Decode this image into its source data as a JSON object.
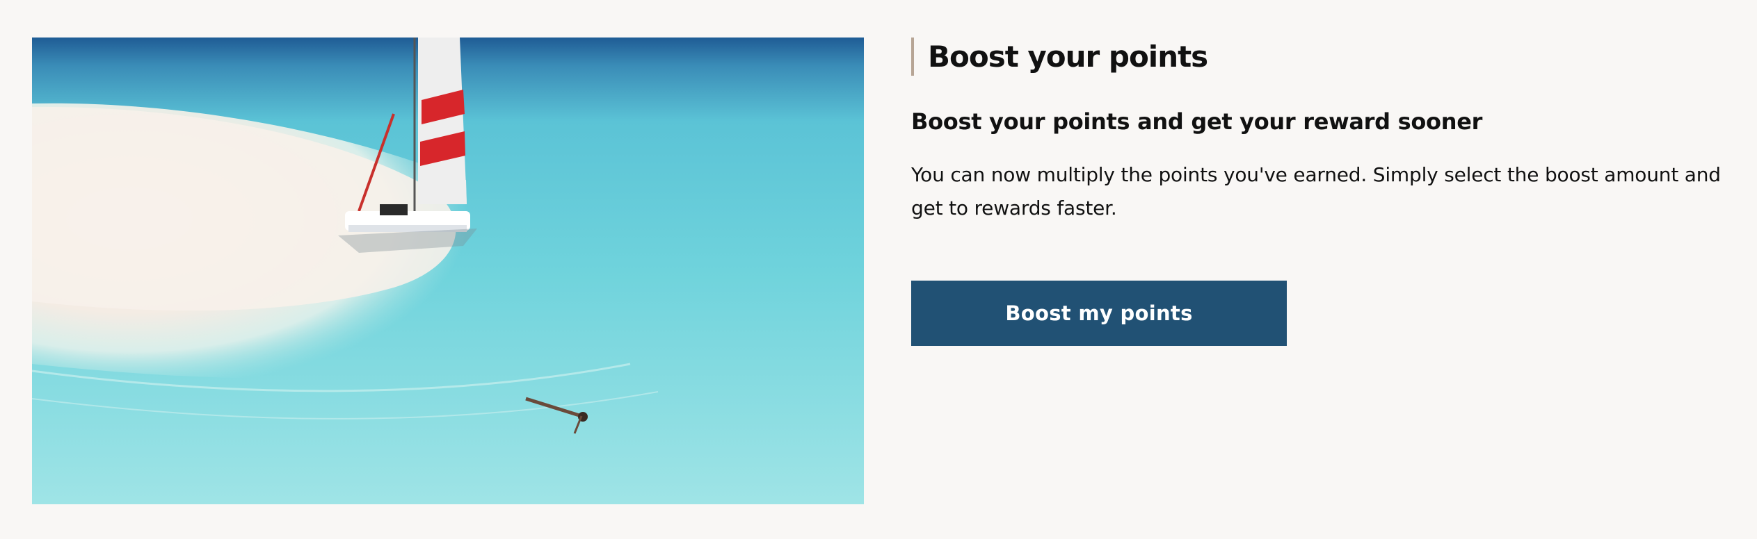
{
  "promo": {
    "image_alt": "Catamaran sailboat on a white sand beach with turquoise water and a person floating",
    "title": "Boost your points",
    "subtitle": "Boost your points and get your reward sooner",
    "description": "You can now multiply the points you've earned. Simply select the boost amount and get to rewards faster.",
    "button_label": "Boost my points"
  },
  "colors": {
    "background": "#f9f7f5",
    "accent_bar": "#b7a595",
    "button_bg": "#215174",
    "button_text": "#ffffff"
  }
}
